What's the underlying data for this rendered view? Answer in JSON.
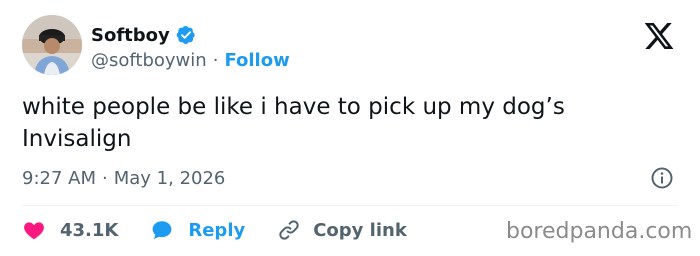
{
  "author": {
    "display_name": "Softboy",
    "handle": "@softboywin",
    "separator": "·",
    "follow_label": "Follow",
    "verified": true
  },
  "tweet": {
    "text": "white people be like i have to pick up my dog’s Invisalign",
    "time": "9:27 AM",
    "separator": "·",
    "date": "May 1, 2026"
  },
  "actions": {
    "likes_count": "43.1K",
    "reply_label": "Reply",
    "copy_link_label": "Copy link"
  },
  "watermark": "boredpanda.com",
  "icons": {
    "platform_logo": "x-logo-icon",
    "verified": "verified-badge-icon",
    "info": "info-icon",
    "like": "heart-icon",
    "reply": "reply-bubble-icon",
    "copy": "link-icon"
  },
  "colors": {
    "text_primary": "#0f1419",
    "text_secondary": "#536471",
    "accent_blue": "#1d9bf0",
    "like_red": "#f91880",
    "divider": "#eff3f4",
    "watermark": "#8b8b8b"
  }
}
